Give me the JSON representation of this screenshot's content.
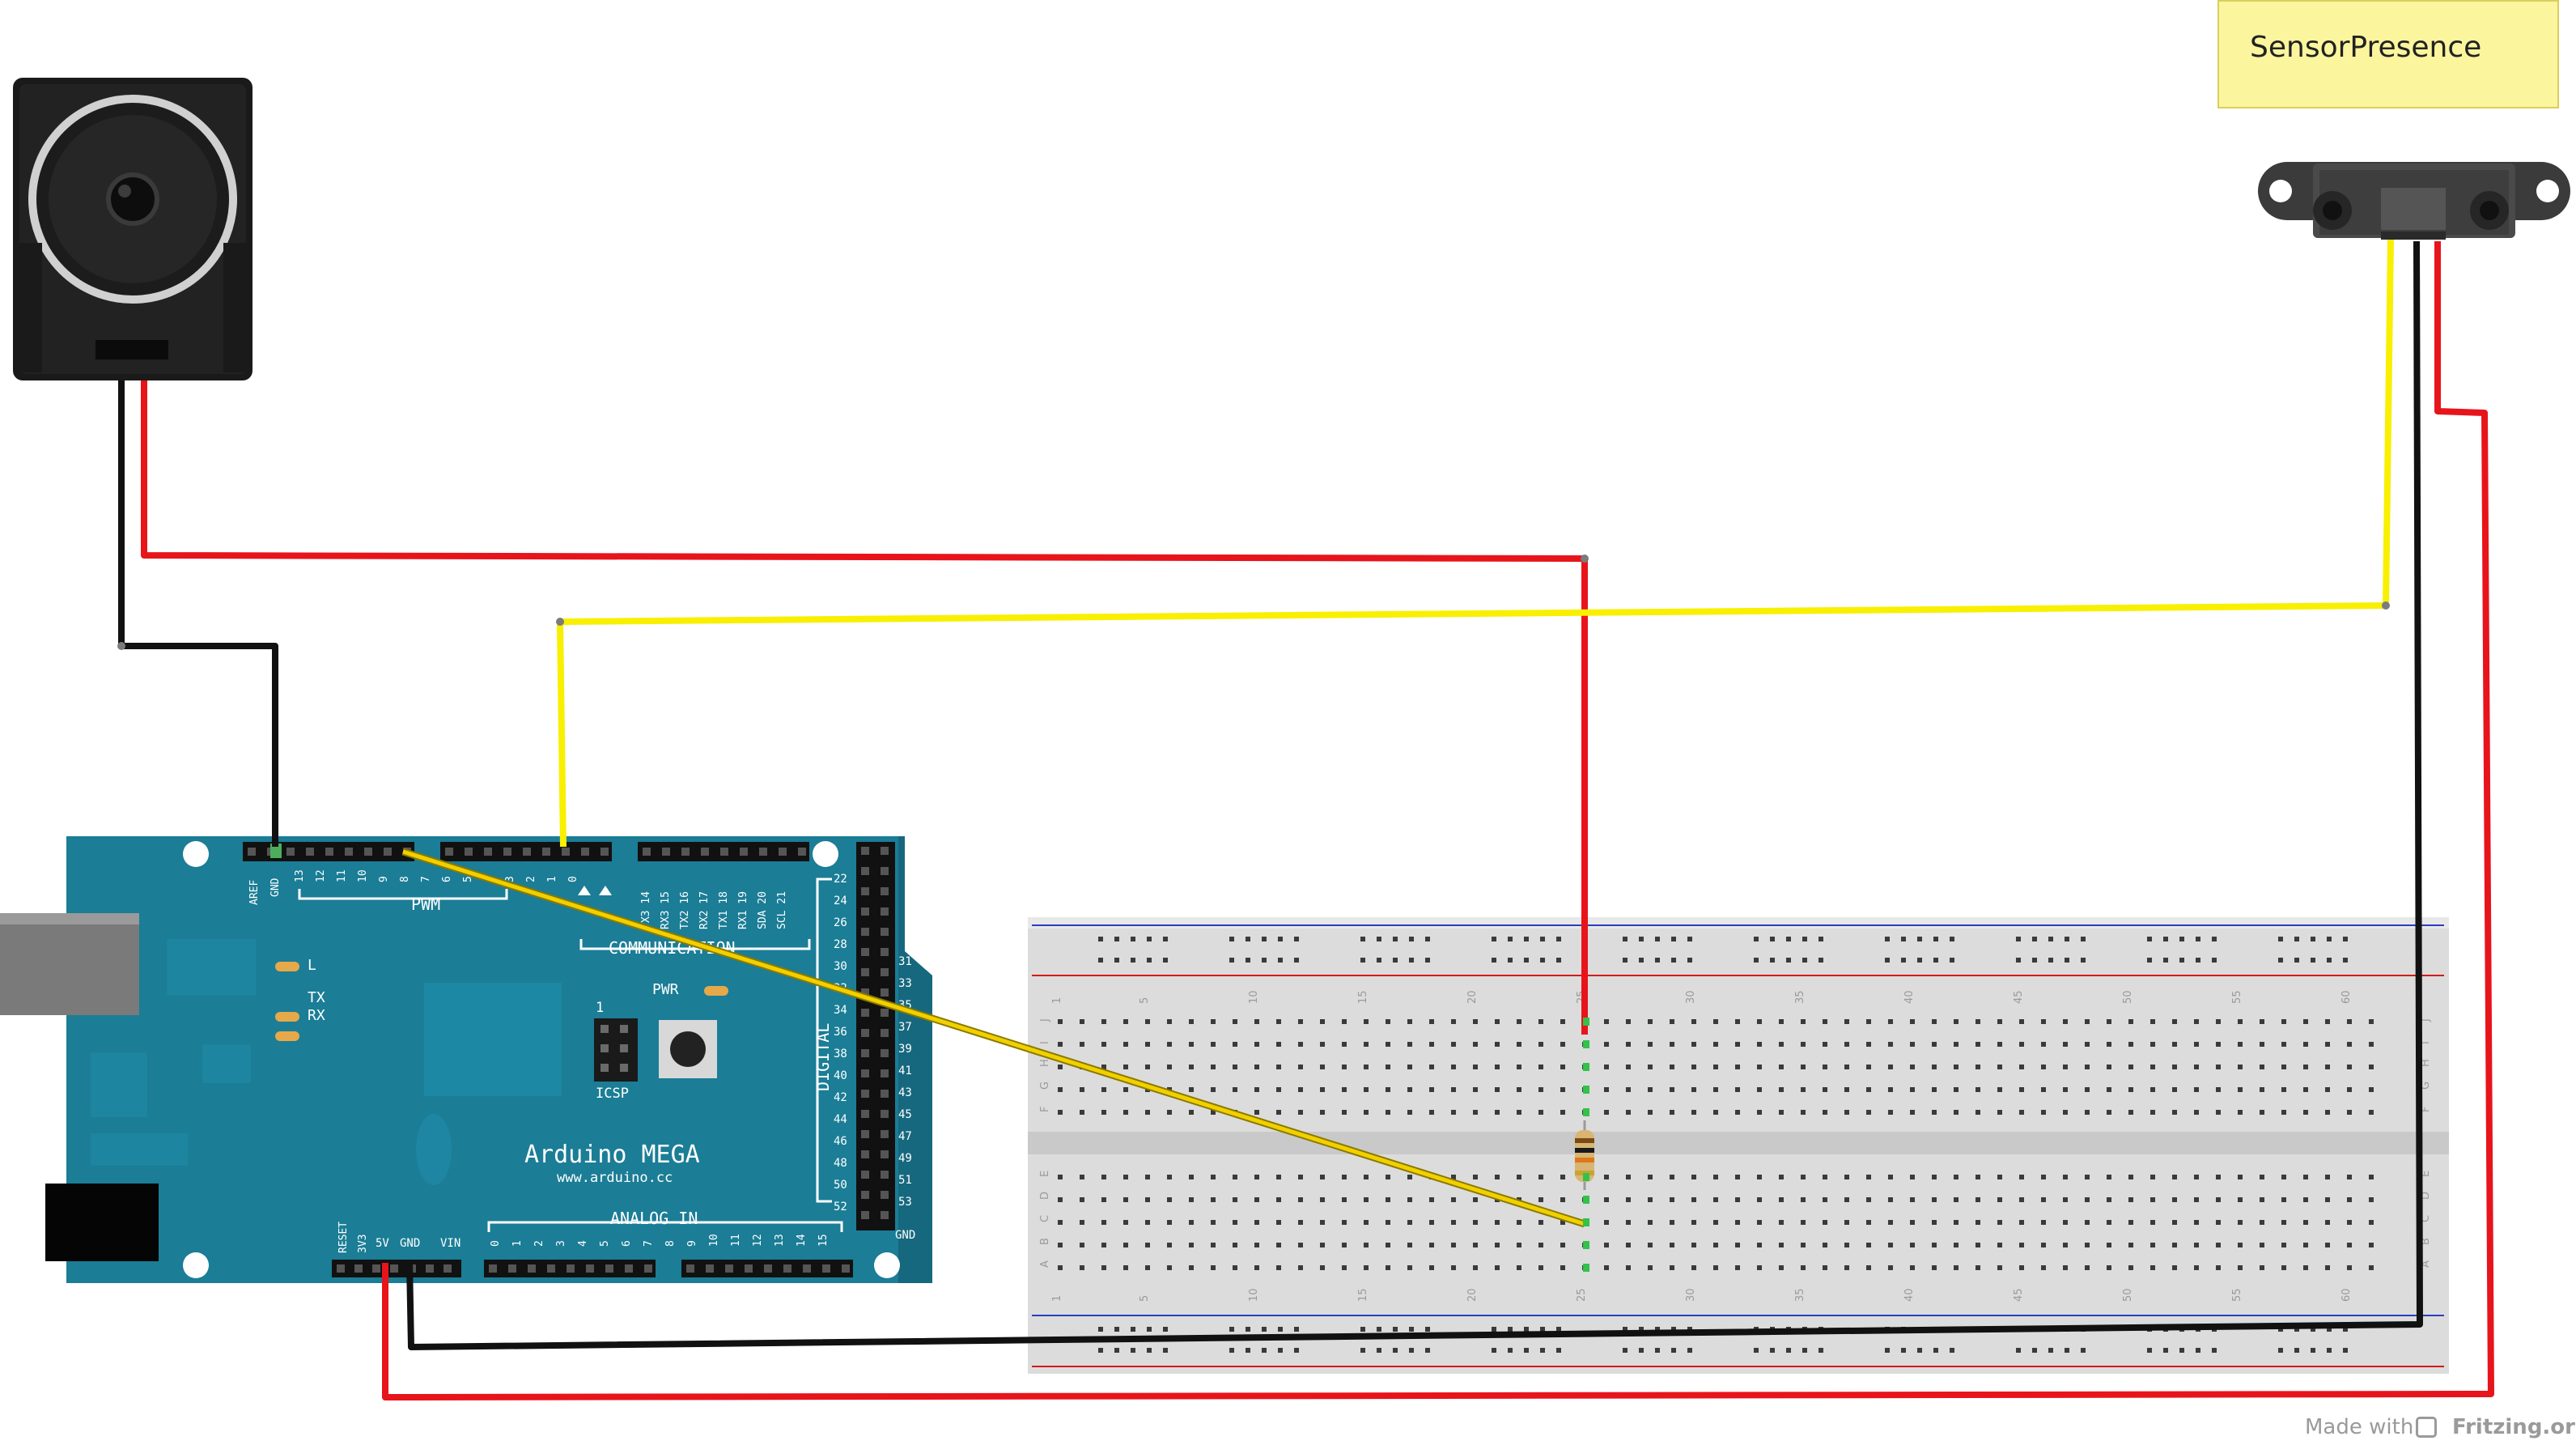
{
  "note": {
    "text": "SensorPresence"
  },
  "arduino": {
    "name": "Arduino MEGA",
    "url": "www.arduino.cc",
    "labels": {
      "pwm": "PWM",
      "communication": "COMMUNICATION",
      "analog_in": "ANALOG IN",
      "digital": "DIGITAL",
      "icsp": "ICSP",
      "pwr": "PWR",
      "led_l": "L",
      "tx": "TX",
      "rx": "RX",
      "aref": "AREF",
      "gnd": "GND",
      "reset": "RESET",
      "v33": "3V3",
      "v5": "5V",
      "vin": "VIN",
      "gnd_right": "GND",
      "icsp_one": "1"
    },
    "pwm_pins": [
      "13",
      "12",
      "11",
      "10",
      "9",
      "8",
      "7",
      "6",
      "5",
      "4",
      "3",
      "2",
      "1",
      "0"
    ],
    "comm_pins": [
      "TX3 14",
      "RX3 15",
      "TX2 16",
      "RX2 17",
      "TX1 18",
      "RX1 19",
      "SDA 20",
      "SCL 21"
    ],
    "analog_pins": [
      "0",
      "1",
      "2",
      "3",
      "4",
      "5",
      "6",
      "7",
      "8",
      "9",
      "10",
      "11",
      "12",
      "13",
      "14",
      "15"
    ],
    "digital_left": [
      "22",
      "24",
      "26",
      "28",
      "30",
      "32",
      "34",
      "36",
      "38",
      "40",
      "42",
      "44",
      "46",
      "48",
      "50",
      "52"
    ],
    "digital_right": [
      "31",
      "33",
      "35",
      "37",
      "39",
      "41",
      "43",
      "45",
      "47",
      "49",
      "51",
      "53"
    ]
  },
  "breadboard": {
    "column_numbers": [
      "1",
      "5",
      "10",
      "15",
      "20",
      "25",
      "30",
      "35",
      "40",
      "45",
      "50",
      "55",
      "60"
    ],
    "row_letters_top": [
      "J",
      "I",
      "H",
      "G",
      "F"
    ],
    "row_letters_bottom": [
      "E",
      "D",
      "C",
      "B",
      "A"
    ]
  },
  "credit": {
    "prefix": "Made with",
    "brand": "Fritzing.org"
  },
  "colors": {
    "wire_red": "#e8141b",
    "wire_black": "#111111",
    "wire_yellow": "#f8f000",
    "board_blue": "#1b7d96",
    "note_yellow": "#fbf59d"
  }
}
